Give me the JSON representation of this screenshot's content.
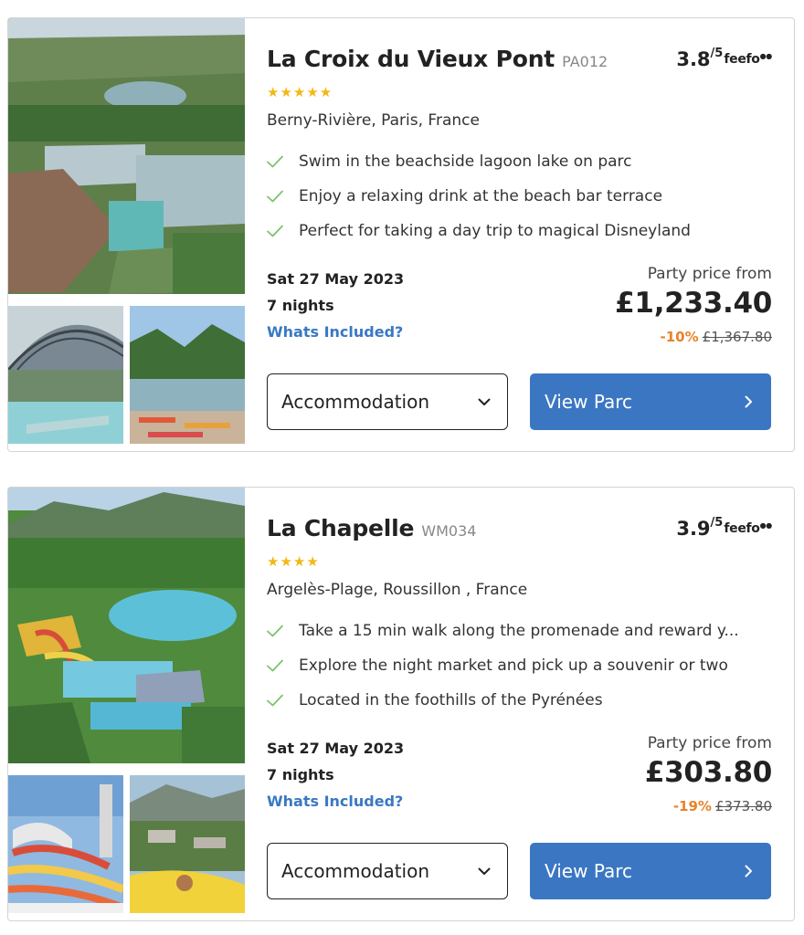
{
  "parcs": [
    {
      "title": "La Croix du Vieux Pont",
      "code": "PA012",
      "rating": "3.8",
      "rating_max": "/5",
      "feefo": "feefo",
      "stars": "★★★★★",
      "star_count": 5,
      "location": "Berny-Rivière, Paris, France",
      "features": [
        "Swim in the beachside lagoon lake on parc",
        "Enjoy a relaxing drink at the beach bar terrace",
        "Perfect for taking a day trip to magical Disneyland"
      ],
      "date": "Sat 27 May 2023",
      "nights": "7 nights",
      "included_link": "Whats Included?",
      "price_label": "Party price from",
      "price": "£1,233.40",
      "discount": "-10%",
      "was_price": "£1,367.80",
      "accommodation_label": "Accommodation",
      "view_button": "View Parc"
    },
    {
      "title": "La Chapelle",
      "code": "WM034",
      "rating": "3.9",
      "rating_max": "/5",
      "feefo": "feefo",
      "stars": "★★★★",
      "star_count": 4,
      "location": "Argelès-Plage, Roussillon , France",
      "features": [
        "Take a 15 min walk along the promenade and reward y...",
        "Explore the night market and pick up a souvenir or two",
        "Located in the foothills of the Pyrénées"
      ],
      "date": "Sat 27 May 2023",
      "nights": "7 nights",
      "included_link": "Whats Included?",
      "price_label": "Party price from",
      "price": "£303.80",
      "discount": "-19%",
      "was_price": "£373.80",
      "accommodation_label": "Accommodation",
      "view_button": "View Parc"
    }
  ],
  "colors": {
    "accent_blue": "#3b76c3",
    "link_blue": "#3a78c2",
    "star_gold": "#f2b814",
    "check_green": "#7cc46a",
    "discount_orange": "#e8822a"
  },
  "icons": {
    "check": "check-icon",
    "chevron_down": "chevron-down-icon",
    "chevron_right": "chevron-right-icon",
    "feefo": "feefo-logo"
  }
}
